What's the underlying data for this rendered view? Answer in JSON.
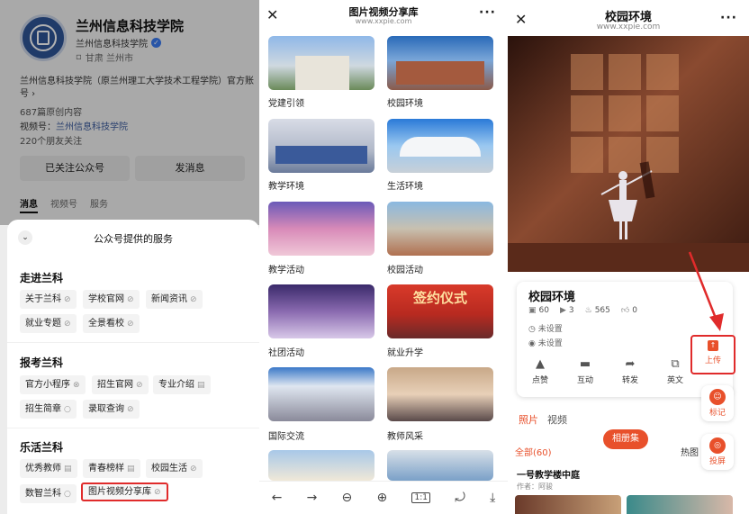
{
  "panel1": {
    "account_name": "兰州信息科技学院",
    "account_sub": "兰州信息科技学院",
    "location": "甘肃 兰州市",
    "description": "兰州信息科技学院（原兰州理工大学技术工程学院）官方账号",
    "article_count": "687篇原创内容",
    "video_label": "视频号：",
    "video_name": "兰州信息科技学院",
    "friends": "220个朋友关注",
    "follow_button": "已关注公众号",
    "message_button": "发消息",
    "tabs": [
      "消息",
      "视频号",
      "服务"
    ],
    "sheet_title": "公众号提供的服务",
    "sections": [
      {
        "title": "走进兰科",
        "items": [
          {
            "label": "关于兰科",
            "icon": "link-icon"
          },
          {
            "label": "学校官网",
            "icon": "link-icon"
          },
          {
            "label": "新闻资讯",
            "icon": "link-icon"
          },
          {
            "label": "就业专题",
            "icon": "link-icon"
          },
          {
            "label": "全景看校",
            "icon": "link-icon"
          }
        ]
      },
      {
        "title": "报考兰科",
        "items": [
          {
            "label": "官方小程序",
            "icon": "mini-program-icon"
          },
          {
            "label": "招生官网",
            "icon": "link-icon"
          },
          {
            "label": "专业介绍",
            "icon": "article-icon"
          },
          {
            "label": "招生简章",
            "icon": "mini-program-icon"
          },
          {
            "label": "录取查询",
            "icon": "link-icon"
          }
        ]
      },
      {
        "title": "乐活兰科",
        "items": [
          {
            "label": "优秀教师",
            "icon": "article-icon"
          },
          {
            "label": "青春榜样",
            "icon": "article-icon"
          },
          {
            "label": "校园生活",
            "icon": "link-icon"
          },
          {
            "label": "数智兰科",
            "icon": "mini-program-icon"
          },
          {
            "label": "图片视频分享库",
            "icon": "link-icon"
          }
        ]
      }
    ]
  },
  "panel2": {
    "title": "图片视频分享库",
    "url": "www.xxpie.com",
    "categories": [
      "党建引领",
      "校园环境",
      "教学环境",
      "生活环境",
      "教学活动",
      "校园活动",
      "社团活动",
      "就业升学",
      "国际交流",
      "教师风采"
    ],
    "tile_overlay_text": "签约仪式",
    "toolbar_icons": [
      "back-arrow-icon",
      "forward-arrow-icon",
      "zoom-out-icon",
      "zoom-in-icon",
      "actual-size-icon",
      "rotate-icon",
      "download-icon"
    ]
  },
  "panel3": {
    "title": "校园环境",
    "url": "www.xxpie.com",
    "album_title": "校园环境",
    "stats": {
      "photos": "60",
      "videos": "3",
      "views": "565",
      "likes": "0"
    },
    "time": "未设置",
    "place": "未设置",
    "actions": [
      "点赞",
      "互动",
      "转发",
      "英文"
    ],
    "upload_label": "上传",
    "mark_label": "标记",
    "cast_label": "投屏",
    "tabs": [
      "照片",
      "视频"
    ],
    "all_count": "全部(60)",
    "album_button": "相册集",
    "hot_label": "热图",
    "photo_title": "一号教学楼中庭",
    "photo_author": "作者：阿骏",
    "accent_color": "#e8502b",
    "highlight_color": "#e02b2b"
  }
}
